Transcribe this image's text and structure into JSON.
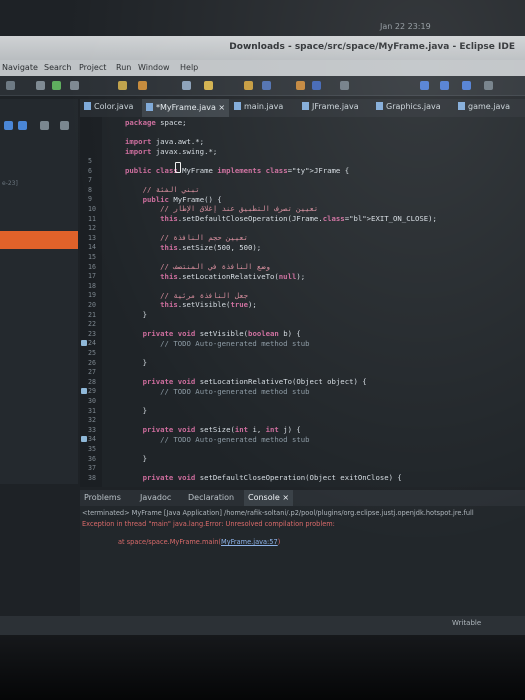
{
  "clock": "Jan 22 23:19",
  "window_title": "Downloads - space/src/space/MyFrame.java - Eclipse IDE",
  "menu": [
    "Navigate",
    "Search",
    "Project",
    "Run",
    "Window",
    "Help"
  ],
  "tabs": [
    {
      "label": "Color.java",
      "active": false
    },
    {
      "label": "*MyFrame.java",
      "active": true
    },
    {
      "label": "main.java",
      "active": false
    },
    {
      "label": "JFrame.java",
      "active": false
    },
    {
      "label": "Graphics.java",
      "active": false
    },
    {
      "label": "game.java",
      "active": false
    }
  ],
  "tab_close": "×",
  "left_panel": {
    "package_label": "e-23]"
  },
  "code_lines": [
    {
      "n": "",
      "t": "package space;"
    },
    {
      "n": "",
      "t": ""
    },
    {
      "n": "",
      "t": "import java.awt.*;"
    },
    {
      "n": "",
      "t": "import javax.swing.*;"
    },
    {
      "n": "5",
      "t": ""
    },
    {
      "n": "6",
      "t": "public class MyFrame implements JFrame {"
    },
    {
      "n": "7",
      "t": ""
    },
    {
      "n": "8",
      "t": "    // تبني الفئة"
    },
    {
      "n": "9",
      "t": "    public MyFrame() {"
    },
    {
      "n": "10",
      "t": "        // تعيين تصرف التطبيق عند إغلاق الإطار"
    },
    {
      "n": "11",
      "t": "        this.setDefaultCloseOperation(JFrame.EXIT_ON_CLOSE);"
    },
    {
      "n": "12",
      "t": ""
    },
    {
      "n": "13",
      "t": "        // تعيين حجم النافذة"
    },
    {
      "n": "14",
      "t": "        this.setSize(500, 500);"
    },
    {
      "n": "15",
      "t": ""
    },
    {
      "n": "16",
      "t": "        // وضع النافذة في المنتصف"
    },
    {
      "n": "17",
      "t": "        this.setLocationRelativeTo(null);"
    },
    {
      "n": "18",
      "t": ""
    },
    {
      "n": "19",
      "t": "        // جعل النافذة مرئية"
    },
    {
      "n": "20",
      "t": "        this.setVisible(true);"
    },
    {
      "n": "21",
      "t": "    }"
    },
    {
      "n": "22",
      "t": ""
    },
    {
      "n": "23",
      "t": "    private void setVisible(boolean b) {"
    },
    {
      "n": "24",
      "t": "        // TODO Auto-generated method stub"
    },
    {
      "n": "25",
      "t": ""
    },
    {
      "n": "26",
      "t": "    }"
    },
    {
      "n": "27",
      "t": ""
    },
    {
      "n": "28",
      "t": "    private void setLocationRelativeTo(Object object) {"
    },
    {
      "n": "29",
      "t": "        // TODO Auto-generated method stub"
    },
    {
      "n": "30",
      "t": ""
    },
    {
      "n": "31",
      "t": "    }"
    },
    {
      "n": "32",
      "t": ""
    },
    {
      "n": "33",
      "t": "    private void setSize(int i, int j) {"
    },
    {
      "n": "34",
      "t": "        // TODO Auto-generated method stub"
    },
    {
      "n": "35",
      "t": ""
    },
    {
      "n": "36",
      "t": "    }"
    },
    {
      "n": "37",
      "t": ""
    },
    {
      "n": "38",
      "t": "    private void setDefaultCloseOperation(Object exitOnClose) {"
    }
  ],
  "console_tabs": [
    {
      "label": "Problems",
      "active": false
    },
    {
      "label": "Javadoc",
      "active": false
    },
    {
      "label": "Declaration",
      "active": false
    },
    {
      "label": "Console",
      "active": true
    }
  ],
  "console": {
    "terminated": "<terminated> MyFrame [Java Application] /home/rafik-soltani/.p2/pool/plugins/org.eclipse.justj.openjdk.hotspot.jre.full",
    "error": "Exception in thread \"main\" java.lang.Error: Unresolved compilation problem:",
    "at_prefix": "at space/space.MyFrame.main(",
    "at_link": "MyFrame.java:57",
    "at_suffix": ")"
  },
  "status": {
    "writable": "Writable"
  }
}
